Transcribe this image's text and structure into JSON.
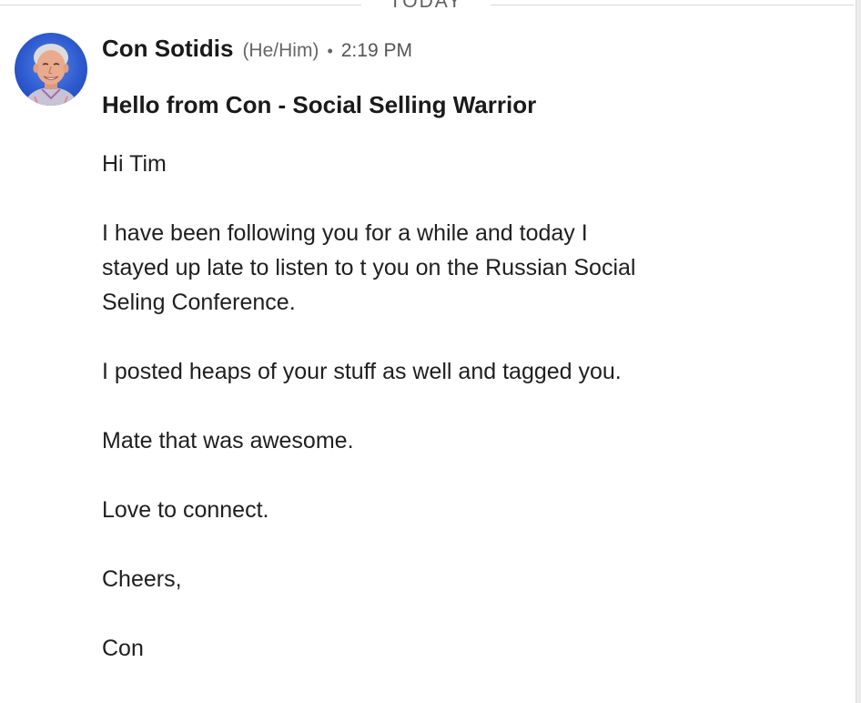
{
  "divider": {
    "label": "TODAY"
  },
  "message": {
    "sender": {
      "name": "Con Sotidis",
      "pronouns": "(He/Him)",
      "separator": "•",
      "time": "2:19 PM"
    },
    "subject": "Hello from Con - Social Selling Warrior",
    "lines": {
      "greeting": "Hi Tim",
      "p1_l1": "I have been following you for a while and today I",
      "p1_l2": "stayed up late to listen to t you on the Russian Social",
      "p1_l3": "Seling Conference.",
      "p2": "I posted heaps of your stuff as well and tagged you.",
      "p3": "Mate that was awesome.",
      "p4": "Love to connect.",
      "signoff": "Cheers,",
      "signature": "Con"
    }
  },
  "colors": {
    "avatar_bg": "#2d5bd0",
    "divider_line": "#d9d9d9",
    "text": "#1f1f1f",
    "muted": "#666666"
  },
  "icons": {
    "avatar": "profile-photo"
  }
}
